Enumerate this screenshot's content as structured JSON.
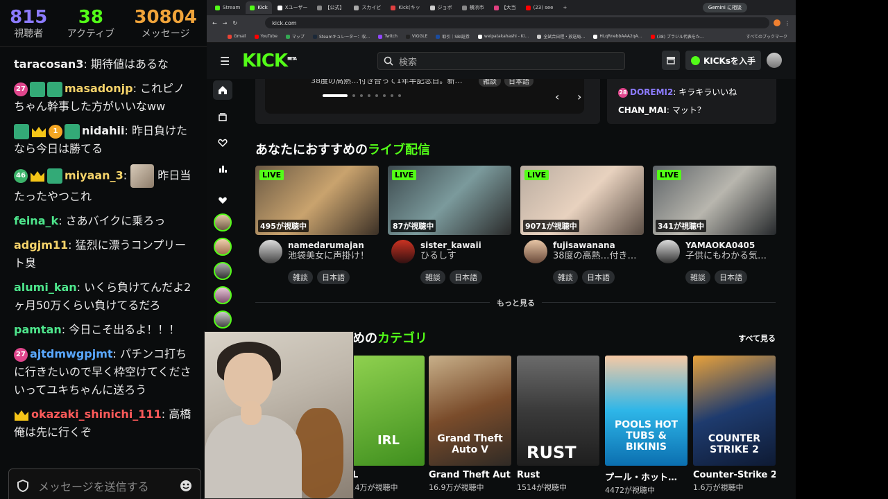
{
  "chat": {
    "stats": [
      {
        "value": "815",
        "label": "視聴者",
        "color": "#8c7bff"
      },
      {
        "value": "38",
        "label": "アクティブ",
        "color": "#53fc18"
      },
      {
        "value": "30804",
        "label": "メッセージ",
        "color": "#f0a43a"
      }
    ],
    "messages": [
      {
        "user": "taracosan3",
        "user_color": "#f0f0f0",
        "text": "期待値はあるな",
        "badges": []
      },
      {
        "user": "masadonjp",
        "user_color": "#f5d36a",
        "text": "これピノちゃん幹事した方がいいなww",
        "badges": [
          "27",
          "sq",
          "sq"
        ]
      },
      {
        "user": "nidahii",
        "user_color": "#f0f0f0",
        "text": "昨日負けたなら今日は勝てる",
        "badges": [
          "sq",
          "crown",
          "1",
          "sq"
        ]
      },
      {
        "user": "miyaan_3",
        "user_color": "#f5d36a",
        "text": "昨日当たったやつこれ",
        "badges": [
          "46",
          "crown",
          "sq"
        ]
      },
      {
        "user": "feina_k",
        "user_color": "#4ee68c",
        "text": "さあバイクに乗ろっ",
        "badges": []
      },
      {
        "user": "adgjm11",
        "user_color": "#f5d36a",
        "text": "猛烈に漂うコンプリート臭",
        "badges": []
      },
      {
        "user": "alumi_kan",
        "user_color": "#4ee68c",
        "text": "いくら負けてんだよ2ヶ月50万くらい負けてるだろ",
        "badges": []
      },
      {
        "user": "pamtan",
        "user_color": "#4ee68c",
        "text": "今日こそ出るよ！！！",
        "badges": []
      },
      {
        "user": "ajtdmwgpjmt",
        "user_color": "#5aa8ff",
        "text": "パチンコ打ちに行きたいので早く枠空けてくださいってユキちゃんに送ろう",
        "badges": [
          "27"
        ]
      },
      {
        "user": "okazaki_shinichi_111",
        "user_color": "#ff5a5a",
        "text": "高橋俺は先に行くぞ",
        "badges": [
          "crown"
        ]
      }
    ],
    "input_placeholder": "メッセージを送信する"
  },
  "browser": {
    "tabs": [
      {
        "label": "Stream",
        "color": "#53fc18"
      },
      {
        "label": "Kick",
        "color": "#53fc18",
        "active": true
      },
      {
        "label": "Xユーザー",
        "color": "#ffffff"
      },
      {
        "label": "【公式】",
        "color": "#888888"
      },
      {
        "label": "スカイビ",
        "color": "#aaaaaa"
      },
      {
        "label": "Kick(キッ",
        "color": "#e04040"
      },
      {
        "label": "ジョボ",
        "color": "#cccccc"
      },
      {
        "label": "横浜市",
        "color": "#888888"
      },
      {
        "label": "【大当",
        "color": "#e04080"
      },
      {
        "label": "(23) see",
        "color": "#ff0000"
      }
    ],
    "gemini_label": "Gemini に相談",
    "url": "kick.com",
    "bookmarks": [
      "Gmail",
      "YouTube",
      "マップ",
      "Steamキュレーター：収…",
      "Twitch",
      "VIGGLE",
      "取引｜SBI証券",
      "weipatakahashi - Ki…",
      "全試合日程・放送局…",
      "HLqRnebbAAA2qA…",
      "(38) ブラジル代表をた…"
    ],
    "bookmarks_all": "すべてのブックマーク"
  },
  "kick": {
    "logo": "KICK",
    "logo_beta": "BETA",
    "search_placeholder": "検索",
    "kicks_button": "KICKsを入手",
    "carousel": {
      "title": "38度の高熱…付き合って1年半記念日。新…",
      "tags": [
        "雑談",
        "日本語"
      ],
      "chat": [
        {
          "badge": "28",
          "user": "DOREMI2",
          "user_color": "#8c7bff",
          "text": "キラキラいいね"
        },
        {
          "user": "CHAN_MAI",
          "user_color": "#ffffff",
          "text": "マット？"
        }
      ]
    },
    "recommended_title_prefix": "あなたにおすすめの",
    "recommended_title_highlight": "ライブ配信",
    "live_label": "LIVE",
    "streams": [
      {
        "viewers": "495が視聴中",
        "name": "namedarumajan",
        "title": "池袋美女に声掛け！",
        "tags": [
          "雑談",
          "日本語"
        ],
        "thumb": "linear-gradient(135deg,#6b5a44,#c9a36e,#3b3026)",
        "av": "linear-gradient(#ddd,#444)"
      },
      {
        "viewers": "87が視聴中",
        "name": "sister_kawaii",
        "title": "ひるしす",
        "tags": [
          "雑談",
          "日本語"
        ],
        "thumb": "linear-gradient(135deg,#3d4a4e,#7b9a9c,#2a2a2a)",
        "av": "linear-gradient(#c32,#311)"
      },
      {
        "viewers": "9071が視聴中",
        "name": "fujisawanana",
        "title": "38度の高熱…付き…",
        "tags": [
          "雑談",
          "日本語"
        ],
        "thumb": "linear-gradient(135deg,#b9aca0,#e8d2bf,#5b4e45)",
        "av": "linear-gradient(#e8c6a6,#6a4a3a)"
      },
      {
        "viewers": "341が視聴中",
        "name": "YAMAOKA0405",
        "title": "子供にもわかる気…",
        "tags": [
          "雑談",
          "日本語"
        ],
        "thumb": "linear-gradient(135deg,#5e6468,#b8b6ae,#26292c)",
        "av": "linear-gradient(#ddd,#333)"
      }
    ],
    "more_label": "もっと見る",
    "categories_title_highlight": "カテゴリ",
    "categories_title_prefix": "めの",
    "see_all": "すべて見る",
    "categories": [
      {
        "name": "L",
        "viewers": ".4万が視聴中",
        "logo": "IRL",
        "bg": "linear-gradient(160deg,#8fd14f,#3f8f1e)"
      },
      {
        "name": "Grand Theft Aut…",
        "viewers": "16.9万が視聴中",
        "logo": "Grand Theft Auto V",
        "bg": "linear-gradient(160deg,#c8b08a,#7a4c2b,#2f2a25)"
      },
      {
        "name": "Rust",
        "viewers": "1514が視聴中",
        "logo": "RUST",
        "bg": "linear-gradient(180deg,#6b6b6b,#3a3a3a,#1e1e1e)"
      },
      {
        "name": "プール・ホット…",
        "viewers": "4472が視聴中",
        "logo": "POOLS HOT TUBS & BIKINIS",
        "bg": "linear-gradient(180deg,#f6c9a4,#2eb6e8,#0b6fb0)"
      },
      {
        "name": "Counter-Strike 2",
        "viewers": "1.6万が視聴中",
        "logo": "COUNTER STRIKE 2",
        "bg": "linear-gradient(160deg,#e9a23b,#1e3b6e,#0e1a33)"
      }
    ]
  }
}
